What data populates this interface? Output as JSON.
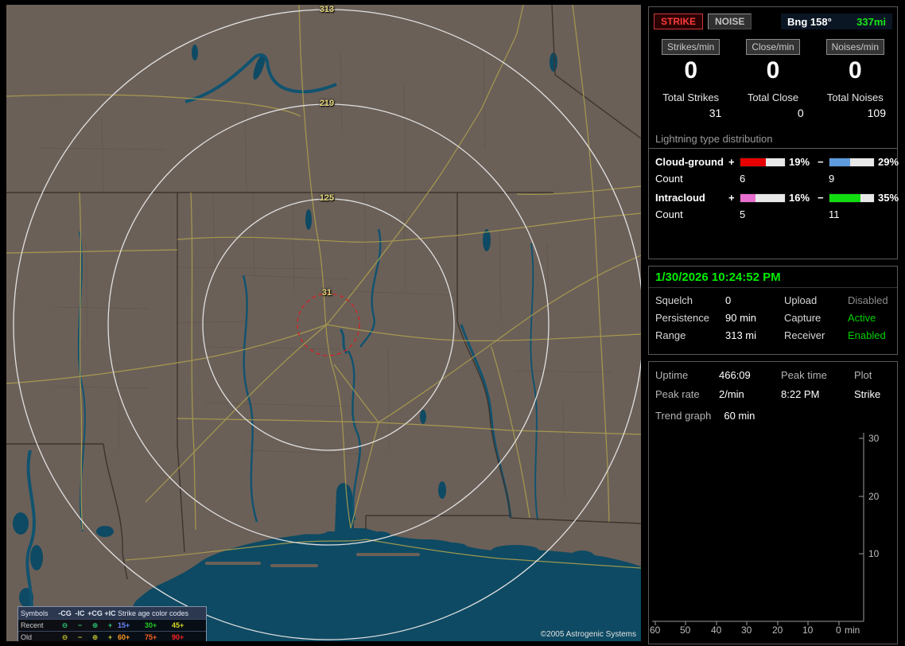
{
  "map": {
    "ring_labels": [
      "313",
      "219",
      "125",
      "31"
    ],
    "copyright": "©2005 Astrogenic Systems",
    "legend": {
      "symbols_header": "Symbols",
      "columns": [
        "-CG",
        "-IC",
        "+CG",
        "+IC"
      ],
      "age_header": "Strike age color codes",
      "symbols": [
        "⊖",
        "−",
        "⊕",
        "+"
      ],
      "rows": [
        {
          "label": "Recent",
          "symbol_color": "#2fc878",
          "ages": [
            {
              "t": "15+",
              "c": "#6d86ff"
            },
            {
              "t": "30+",
              "c": "#22cc22"
            },
            {
              "t": "45+",
              "c": "#d8d822"
            }
          ]
        },
        {
          "label": "Old",
          "symbol_color": "#c8c832",
          "ages": [
            {
              "t": "60+",
              "c": "#ff9922"
            },
            {
              "t": "75+",
              "c": "#ff6022"
            },
            {
              "t": "90+",
              "c": "#ff2222"
            }
          ]
        }
      ]
    }
  },
  "toolbar": {
    "strike": "STRIKE",
    "noise": "NOISE",
    "bearing": "Bng 158°",
    "distance": "337mi"
  },
  "rates": {
    "headers": [
      "Strikes/min",
      "Close/min",
      "Noises/min"
    ],
    "values": [
      "0",
      "0",
      "0"
    ],
    "totals": [
      {
        "label": "Total Strikes",
        "value": "31"
      },
      {
        "label": "Total Close",
        "value": "0"
      },
      {
        "label": "Total Noises",
        "value": "109"
      }
    ]
  },
  "distribution": {
    "title": "Lightning type distribution",
    "count_label": "Count",
    "rows": [
      {
        "name": "Cloud-ground",
        "plus_sign": "+",
        "minus_sign": "−",
        "plus_pct": "19%",
        "plus_width": "58%",
        "plus_color": "#e80000",
        "plus_count": "6",
        "minus_pct": "29%",
        "minus_width": "46%",
        "minus_color": "#5f9bdc",
        "minus_count": "9"
      },
      {
        "name": "Intracloud",
        "plus_sign": "+",
        "minus_sign": "−",
        "plus_pct": "16%",
        "plus_width": "34%",
        "plus_color": "#e86fd0",
        "plus_count": "5",
        "minus_pct": "35%",
        "minus_width": "70%",
        "minus_color": "#10dd10",
        "minus_count": "11"
      }
    ]
  },
  "status": {
    "datetime": "1/30/2026 10:24:52 PM",
    "rows": [
      {
        "l1": "Squelch",
        "v1": "0",
        "l2": "Upload",
        "v2": "Disabled",
        "v2_color": "#8c8c8c"
      },
      {
        "l1": "Persistence",
        "v1": "90 min",
        "l2": "Capture",
        "v2": "Active",
        "v2_color": "#00d000"
      },
      {
        "l1": "Range",
        "v1": "313 mi",
        "l2": "Receiver",
        "v2": "Enabled",
        "v2_color": "#00d000"
      }
    ]
  },
  "stats": {
    "uptime_label": "Uptime",
    "uptime_value": "466:09",
    "peaktime_label": "Peak time",
    "plot_label": "Plot",
    "peakrate_label": "Peak rate",
    "peakrate_value": "2/min",
    "peaktime_value": "8:22 PM",
    "plot_value": "Strike",
    "trend_label": "Trend graph",
    "trend_value": "60 min"
  },
  "chart_data": {
    "type": "line",
    "title": "Trend graph (60 min)",
    "xlabel": "min",
    "x_ticks": [
      "60",
      "50",
      "40",
      "30",
      "20",
      "10",
      "0"
    ],
    "x_unit": "min",
    "y_ticks": [
      "30",
      "20",
      "10"
    ],
    "ylim": [
      0,
      30
    ],
    "series": []
  }
}
